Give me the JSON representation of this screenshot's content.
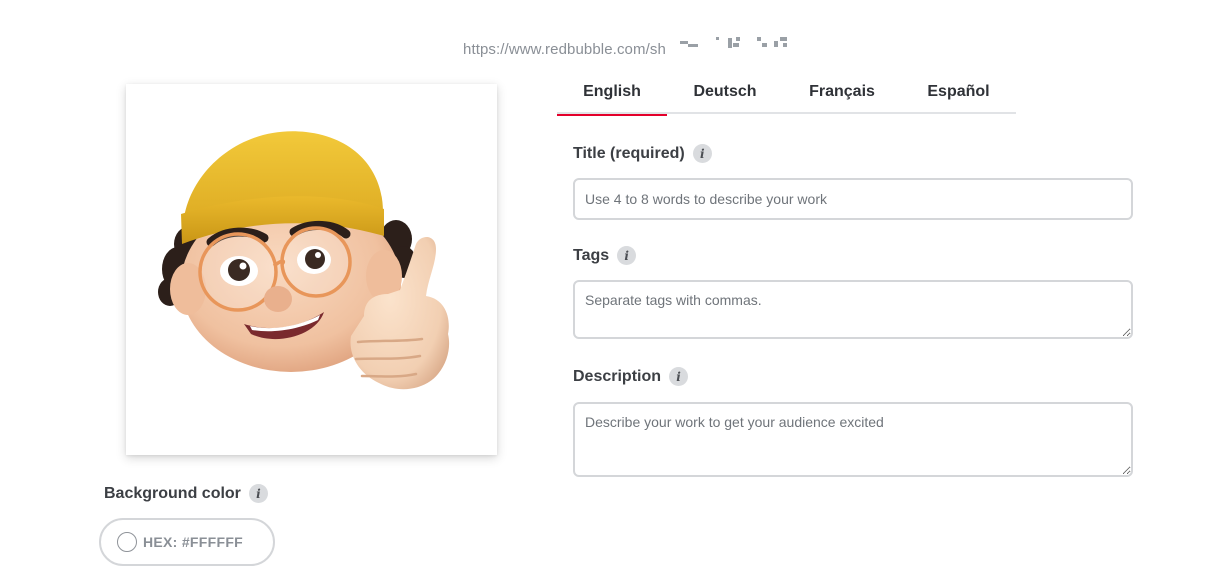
{
  "url": {
    "text": "https://www.redbubble.com/sh"
  },
  "artwork": {
    "alt": "memoji-thumbs-up"
  },
  "background": {
    "label": "Background color",
    "hex_label": "HEX: #FFFFFF",
    "swatch_color": "#FFFFFF"
  },
  "tabs": [
    {
      "label": "English",
      "active": true
    },
    {
      "label": "Deutsch",
      "active": false
    },
    {
      "label": "Français",
      "active": false
    },
    {
      "label": "Español",
      "active": false
    }
  ],
  "fields": {
    "title": {
      "label": "Title (required)",
      "placeholder": "Use 4 to 8 words to describe your work",
      "value": ""
    },
    "tags": {
      "label": "Tags",
      "placeholder": "Separate tags with commas.",
      "value": ""
    },
    "description": {
      "label": "Description",
      "placeholder": "Describe your work to get your audience excited",
      "value": ""
    }
  },
  "icons": {
    "info": "info-icon",
    "info_glyph": "i"
  },
  "colors": {
    "accent": "#e4002b",
    "border": "#d4d6d9",
    "info_bg": "#d9dbde"
  }
}
